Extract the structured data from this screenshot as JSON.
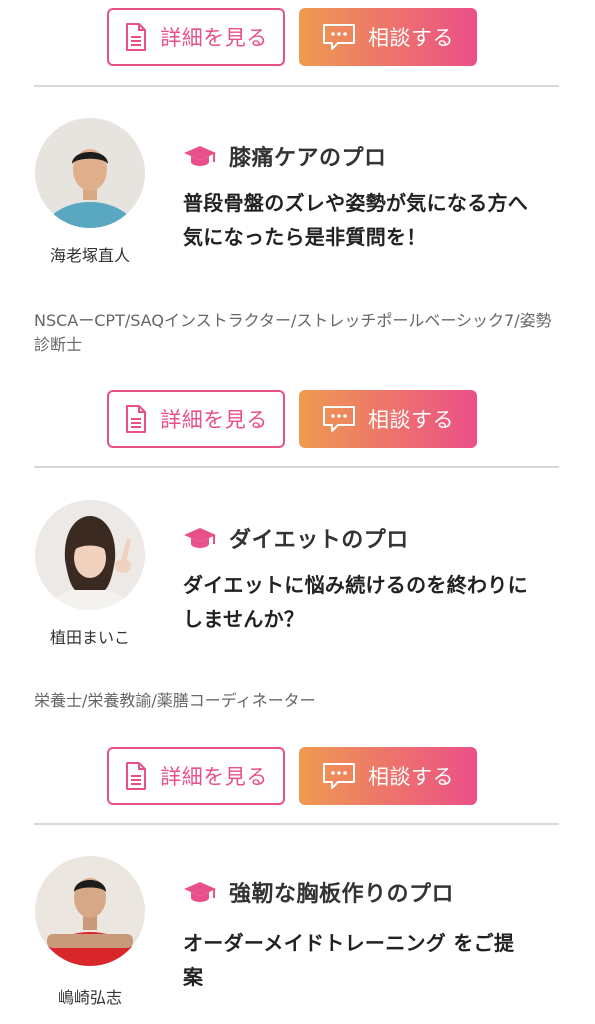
{
  "buttons": {
    "detail_label": "詳細を見る",
    "consult_label": "相談する"
  },
  "icons": {
    "detail": "document-icon",
    "consult": "chat-bubble-icon",
    "specialty": "graduation-cap-icon"
  },
  "colors": {
    "accent_pink": "#e8508a",
    "gradient_start": "#ee9a4f",
    "gradient_end": "#ec4f87",
    "divider": "#d8d8d8"
  },
  "trainers": [
    {
      "name": "海老塚直人",
      "specialty": "膝痛ケアのプロ",
      "catch": "普段骨盤のズレや姿勢が気になる方へ 気になったら是非質問を！",
      "qualifications": "NSCAーCPT/SAQインストラクター/ストレッチポールベーシック7/姿勢診断士"
    },
    {
      "name": "植田まいこ",
      "specialty": "ダイエットのプロ",
      "catch": "ダイエットに悩み続けるのを終わりにしませんか？",
      "qualifications": "栄養士/栄養教諭/薬膳コーディネーター"
    },
    {
      "name": "嶋崎弘志",
      "specialty": "強靭な胸板作りのプロ",
      "catch": "オーダーメイドトレーニング をご提案",
      "qualifications": ""
    }
  ]
}
